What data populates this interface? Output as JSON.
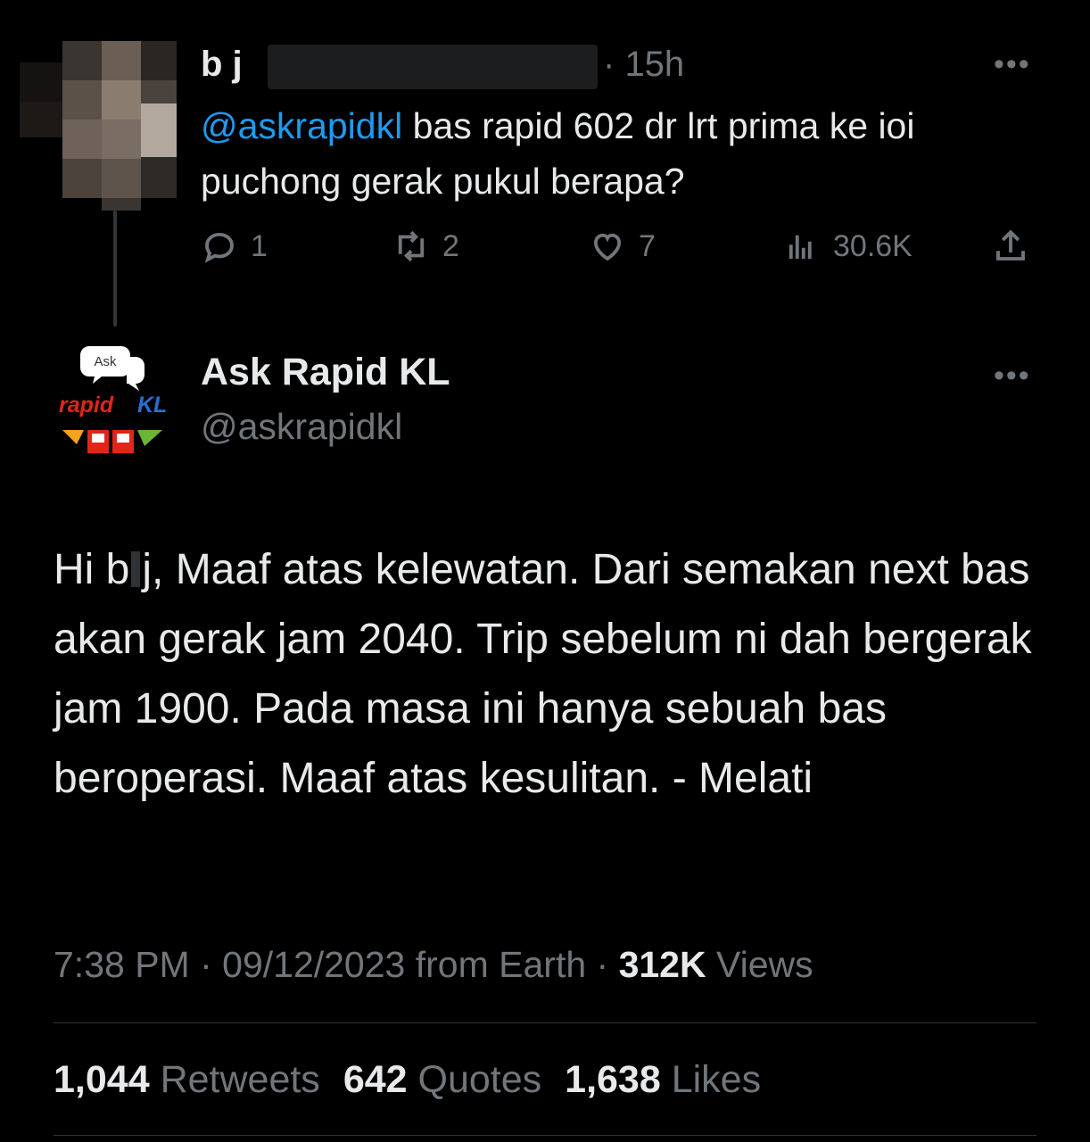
{
  "reply_to": {
    "author_name": "b j",
    "time": "15h",
    "mention": "@askrapidkl",
    "text": " bas rapid 602 dr lrt prima ke ioi puchong gerak pukul berapa?",
    "actions": {
      "replies": "1",
      "retweets": "2",
      "likes": "7",
      "views": "30.6K"
    }
  },
  "tweet": {
    "author_name": "Ask Rapid KL",
    "handle": "@askrapidkl",
    "logo": {
      "bubble_text": "Ask",
      "brand_text_1": "rapid",
      "brand_text_2": "KL"
    },
    "body_prefix": "Hi b",
    "body_rest": "j, Maaf atas kelewatan. Dari semakan next bas akan gerak jam  2040. Trip sebelum ni dah bergerak jam 1900. Pada masa ini hanya sebuah bas beroperasi. Maaf atas kesulitan. - Melati",
    "time": "7:38 PM",
    "date": "09/12/2023",
    "source": "from Earth",
    "views_count": "312K",
    "views_label": "Views",
    "retweets_count": "1,044",
    "retweets_label": "Retweets",
    "quotes_count": "642",
    "quotes_label": "Quotes",
    "likes_count": "1,638",
    "likes_label": "Likes"
  },
  "icons": [
    "reply-icon",
    "retweet-icon",
    "like-icon",
    "views-icon",
    "share-icon",
    "more-icon"
  ],
  "colors": {
    "background": "#000000",
    "text": "#e7e9ea",
    "secondary": "#71767b",
    "link": "#1d9bf0",
    "brand_red": "#e1251b"
  }
}
